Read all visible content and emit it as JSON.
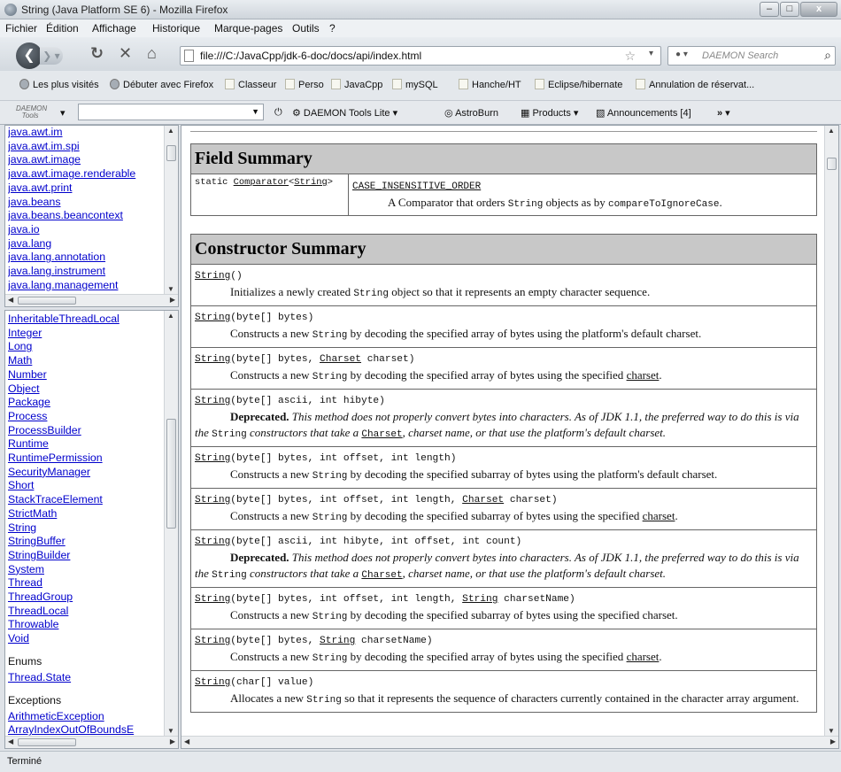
{
  "window": {
    "title": "String (Java Platform SE 6) - Mozilla Firefox",
    "min": "–",
    "max": "□",
    "close": "x"
  },
  "menu": [
    "Fichier",
    "Édition",
    "Affichage",
    "Historique",
    "Marque-pages",
    "Outils",
    "?"
  ],
  "nav": {
    "url": "file:///C:/JavaCpp/jdk-6-doc/docs/api/index.html",
    "search_placeholder": "DAEMON Search"
  },
  "bookmarks": [
    "Les plus visités",
    "Débuter avec Firefox",
    "Classeur",
    "Perso",
    "JavaCpp",
    "mySQL",
    "Hanche/HT",
    "Eclipse/hibernate",
    "Annulation de réservat..."
  ],
  "daemon": {
    "logo_line1": "DAEMON",
    "logo_line2": "Tools",
    "items": [
      "DAEMON Tools Lite",
      "AstroBurn",
      "Products",
      "Announcements [4]"
    ],
    "more": "»"
  },
  "packages": [
    "java.awt.im",
    "java.awt.im.spi",
    "java.awt.image",
    "java.awt.image.renderable",
    "java.awt.print",
    "java.beans",
    "java.beans.beancontext",
    "java.io",
    "java.lang",
    "java.lang.annotation",
    "java.lang.instrument",
    "java.lang.management"
  ],
  "classes": {
    "items": [
      "InheritableThreadLocal",
      "Integer",
      "Long",
      "Math",
      "Number",
      "Object",
      "Package",
      "Process",
      "ProcessBuilder",
      "Runtime",
      "RuntimePermission",
      "SecurityManager",
      "Short",
      "StackTraceElement",
      "StrictMath",
      "String",
      "StringBuffer",
      "StringBuilder",
      "System",
      "Thread",
      "ThreadGroup",
      "ThreadLocal",
      "Throwable",
      "Void"
    ],
    "enums_header": "Enums",
    "enums": [
      "Thread.State"
    ],
    "exceptions_header": "Exceptions",
    "exceptions": [
      "ArithmeticException",
      "ArrayIndexOutOfBoundsE"
    ]
  },
  "field_summary": {
    "title": "Field Summary",
    "modifier": "static",
    "type_link": "Comparator",
    "type_param": "String",
    "name": "CASE_INSENSITIVE_ORDER",
    "desc_a": "A Comparator that orders",
    "desc_code": "String",
    "desc_b": "objects as by",
    "desc_code2": "compareToIgnoreCase",
    "desc_end": "."
  },
  "constructor_summary": {
    "title": "Constructor Summary",
    "c1": {
      "name": "String",
      "params": "()",
      "d1": "Initializes a newly created",
      "code": "String",
      "d2": "object so that it represents an empty character sequence."
    },
    "c2": {
      "name": "String",
      "params": "(byte[] bytes)",
      "d1": "Constructs a new",
      "code": "String",
      "d2": "by decoding the specified array of bytes using the platform's default charset."
    },
    "c3": {
      "name": "String",
      "p1": "(byte[] bytes,",
      "type": "Charset",
      "p2": "charset)",
      "d1": "Constructs a new",
      "code": "String",
      "d2": "by decoding the specified array of bytes using the specified",
      "link": "charset",
      "d3": "."
    },
    "c4": {
      "name": "String",
      "params": "(byte[] ascii, int hibyte)",
      "label": "Deprecated.",
      "d1": "This method does not properly convert bytes into characters. As of JDK 1.1, the preferred way to do this is via the",
      "code": "String",
      "d2": "constructors that take a",
      "link": "Charset",
      "d3": ", charset name, or that use the platform's default charset."
    },
    "c5": {
      "name": "String",
      "params": "(byte[] bytes, int offset, int length)",
      "d1": "Constructs a new",
      "code": "String",
      "d2": "by decoding the specified subarray of bytes using the platform's default charset."
    },
    "c6": {
      "name": "String",
      "p1": "(byte[] bytes, int offset, int length,",
      "type": "Charset",
      "p2": "charset)",
      "d1": "Constructs a new",
      "code": "String",
      "d2": "by decoding the specified subarray of bytes using the specified",
      "link": "charset",
      "d3": "."
    },
    "c7": {
      "name": "String",
      "params": "(byte[] ascii, int hibyte, int offset, int count)",
      "label": "Deprecated.",
      "d1": "This method does not properly convert bytes into characters. As of JDK 1.1, the preferred way to do this is via the",
      "code": "String",
      "d2": "constructors that take a",
      "link": "Charset",
      "d3": ", charset name, or that use the platform's default charset."
    },
    "c8": {
      "name": "String",
      "p1": "(byte[] bytes, int offset, int length,",
      "type": "String",
      "p2": "charsetName)",
      "d1": "Constructs a new",
      "code": "String",
      "d2": "by decoding the specified subarray of bytes using the specified charset."
    },
    "c9": {
      "name": "String",
      "p1": "(byte[] bytes,",
      "type": "String",
      "p2": "charsetName)",
      "d1": "Constructs a new",
      "code": "String",
      "d2": "by decoding the specified array of bytes using the specified",
      "link": "charset",
      "d3": "."
    },
    "c10": {
      "name": "String",
      "params": "(char[] value)",
      "d1": "Allocates a new",
      "code": "String",
      "d2": "so that it represents the sequence of characters currently contained in the character array argument."
    }
  },
  "status": "Terminé"
}
